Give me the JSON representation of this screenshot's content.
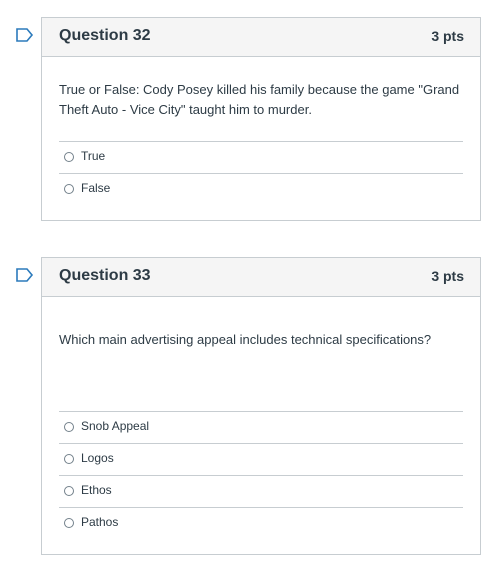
{
  "questions": [
    {
      "title": "Question 32",
      "points": "3 pts",
      "text": "True or False: Cody Posey killed his family because the game \"Grand Theft Auto - Vice City\" taught him to murder.",
      "answers": [
        "True",
        "False"
      ]
    },
    {
      "title": "Question 33",
      "points": "3 pts",
      "text": "Which main advertising appeal includes technical specifications?",
      "answers": [
        "Snob Appeal",
        "Logos",
        "Ethos",
        "Pathos"
      ]
    }
  ],
  "icons": {
    "flag": "flag-icon",
    "radio": "radio-icon"
  },
  "colors": {
    "border": "#c7cdd1",
    "header_bg": "#f5f5f5",
    "text": "#2d3b45",
    "flag": "#2b7abc"
  }
}
